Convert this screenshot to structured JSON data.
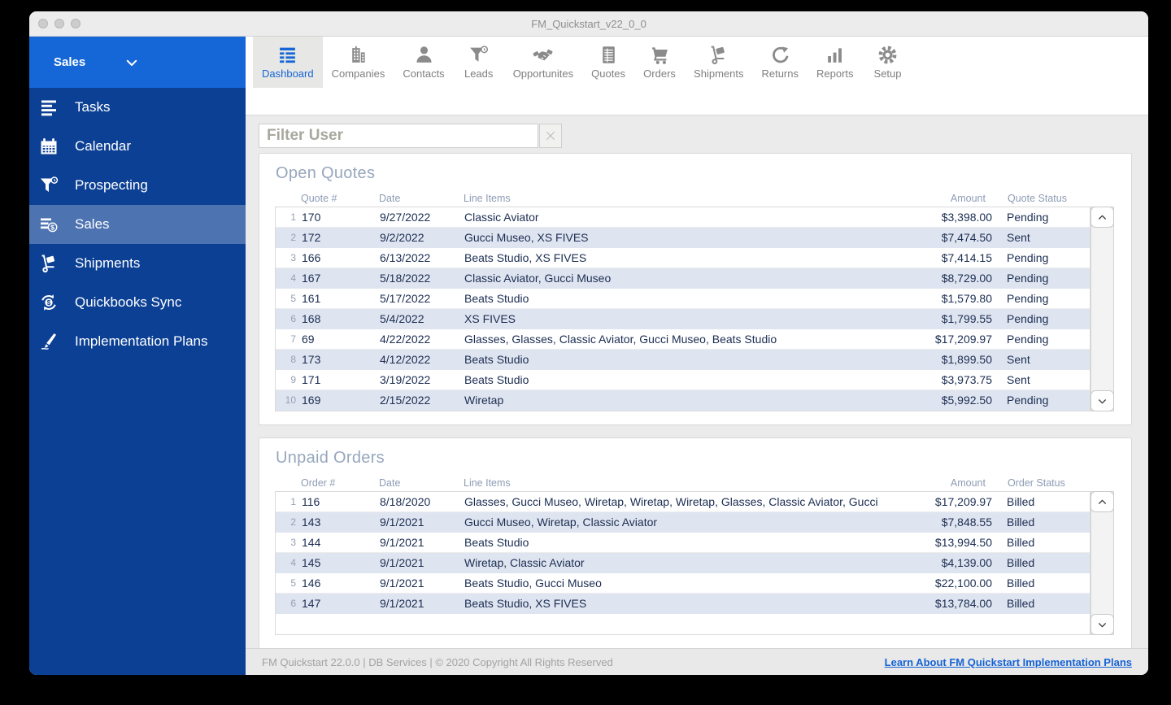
{
  "window": {
    "title": "FM_Quickstart_v22_0_0"
  },
  "titlebar_buttons": [
    {
      "name": "close-button"
    },
    {
      "name": "minimize-button"
    },
    {
      "name": "zoom-button"
    }
  ],
  "sidebar": {
    "header_label": "Sales",
    "header_icon": "chevron-down-icon",
    "items": [
      {
        "label": "Tasks",
        "icon": "tasks-icon",
        "selected": false
      },
      {
        "label": "Calendar",
        "icon": "calendar-icon",
        "selected": false
      },
      {
        "label": "Prospecting",
        "icon": "prospecting-icon",
        "selected": false
      },
      {
        "label": "Sales",
        "icon": "sales-icon",
        "selected": true
      },
      {
        "label": "Shipments",
        "icon": "shipments-icon",
        "selected": false
      },
      {
        "label": "Quickbooks Sync",
        "icon": "quickbooks-sync-icon",
        "selected": false
      },
      {
        "label": "Implementation Plans",
        "icon": "implementation-plans-icon",
        "selected": false
      }
    ]
  },
  "toolbar": {
    "tabs": [
      {
        "label": "Dashboard",
        "icon": "dashboard-icon",
        "selected": true
      },
      {
        "label": "Companies",
        "icon": "companies-icon",
        "selected": false
      },
      {
        "label": "Contacts",
        "icon": "contacts-icon",
        "selected": false
      },
      {
        "label": "Leads",
        "icon": "leads-icon",
        "selected": false
      },
      {
        "label": "Opportunites",
        "icon": "opportunities-icon",
        "selected": false
      },
      {
        "label": "Quotes",
        "icon": "quotes-icon",
        "selected": false
      },
      {
        "label": "Orders",
        "icon": "orders-icon",
        "selected": false
      },
      {
        "label": "Shipments",
        "icon": "shipments-icon",
        "selected": false
      },
      {
        "label": "Returns",
        "icon": "returns-icon",
        "selected": false
      },
      {
        "label": "Reports",
        "icon": "reports-icon",
        "selected": false
      },
      {
        "label": "Setup",
        "icon": "setup-icon",
        "selected": false
      }
    ]
  },
  "filter": {
    "placeholder": "Filter User",
    "clear_icon": "close-icon"
  },
  "open_quotes": {
    "title": "Open Quotes",
    "columns": [
      "Quote #",
      "Date",
      "Line Items",
      "Amount",
      "Quote Status"
    ],
    "rows": [
      {
        "num": 1,
        "id": "170",
        "date": "9/27/2022",
        "line_items": "Classic Aviator",
        "amount": "$3,398.00",
        "status": "Pending"
      },
      {
        "num": 2,
        "id": "172",
        "date": "9/2/2022",
        "line_items": "Gucci Museo, XS FIVES",
        "amount": "$7,474.50",
        "status": "Sent"
      },
      {
        "num": 3,
        "id": "166",
        "date": "6/13/2022",
        "line_items": "Beats Studio, XS FIVES",
        "amount": "$7,414.15",
        "status": "Pending"
      },
      {
        "num": 4,
        "id": "167",
        "date": "5/18/2022",
        "line_items": "Classic Aviator, Gucci Museo",
        "amount": "$8,729.00",
        "status": "Pending"
      },
      {
        "num": 5,
        "id": "161",
        "date": "5/17/2022",
        "line_items": "Beats Studio",
        "amount": "$1,579.80",
        "status": "Pending"
      },
      {
        "num": 6,
        "id": "168",
        "date": "5/4/2022",
        "line_items": "XS FIVES",
        "amount": "$1,799.55",
        "status": "Pending"
      },
      {
        "num": 7,
        "id": "69",
        "date": "4/22/2022",
        "line_items": "Glasses, Glasses, Classic Aviator, Gucci Museo, Beats Studio",
        "amount": "$17,209.97",
        "status": "Pending"
      },
      {
        "num": 8,
        "id": "173",
        "date": "4/12/2022",
        "line_items": "Beats Studio",
        "amount": "$1,899.50",
        "status": "Sent"
      },
      {
        "num": 9,
        "id": "171",
        "date": "3/19/2022",
        "line_items": "Beats Studio",
        "amount": "$3,973.75",
        "status": "Sent"
      },
      {
        "num": 10,
        "id": "169",
        "date": "2/15/2022",
        "line_items": "Wiretap",
        "amount": "$5,992.50",
        "status": "Pending"
      }
    ]
  },
  "unpaid_orders": {
    "title": "Unpaid Orders",
    "columns": [
      "Order #",
      "Date",
      "Line Items",
      "Amount",
      "Order Status"
    ],
    "rows": [
      {
        "num": 1,
        "id": "116",
        "date": "8/18/2020",
        "line_items": "Glasses, Gucci Museo, Wiretap, Wiretap, Wiretap, Glasses, Classic Aviator, Gucci",
        "amount": "$17,209.97",
        "status": "Billed"
      },
      {
        "num": 2,
        "id": "143",
        "date": "9/1/2021",
        "line_items": "Gucci Museo, Wiretap, Classic Aviator",
        "amount": "$7,848.55",
        "status": "Billed"
      },
      {
        "num": 3,
        "id": "144",
        "date": "9/1/2021",
        "line_items": "Beats Studio",
        "amount": "$13,994.50",
        "status": "Billed"
      },
      {
        "num": 4,
        "id": "145",
        "date": "9/1/2021",
        "line_items": "Wiretap, Classic Aviator",
        "amount": "$4,139.00",
        "status": "Billed"
      },
      {
        "num": 5,
        "id": "146",
        "date": "9/1/2021",
        "line_items": "Beats Studio, Gucci Museo",
        "amount": "$22,100.00",
        "status": "Billed"
      },
      {
        "num": 6,
        "id": "147",
        "date": "9/1/2021",
        "line_items": "Beats Studio, XS FIVES",
        "amount": "$13,784.00",
        "status": "Billed"
      }
    ]
  },
  "scrollbars": {
    "up_icon": "chevron-up-icon",
    "down_icon": "chevron-down-icon"
  },
  "footer": {
    "text": "FM Quickstart 22.0.0  | DB Services | © 2020 Copyright All Rights Reserved",
    "link_label": "Learn About FM Quickstart Implementation Plans"
  },
  "colors": {
    "sidebar_header_blue": "#1567d8",
    "sidebar_body_blue": "#0c4094",
    "sidebar_selected_blue": "#4d73b1",
    "accent_blue": "#1565d6",
    "row_alt_background": "#dfe5f0",
    "row_text_navy": "#1b2d52",
    "column_header_gray_blue": "#8d9cb4",
    "panel_title_gray_blue": "#97a7bd",
    "content_background": "#ebebeb",
    "link_blue": "#1563d6"
  }
}
